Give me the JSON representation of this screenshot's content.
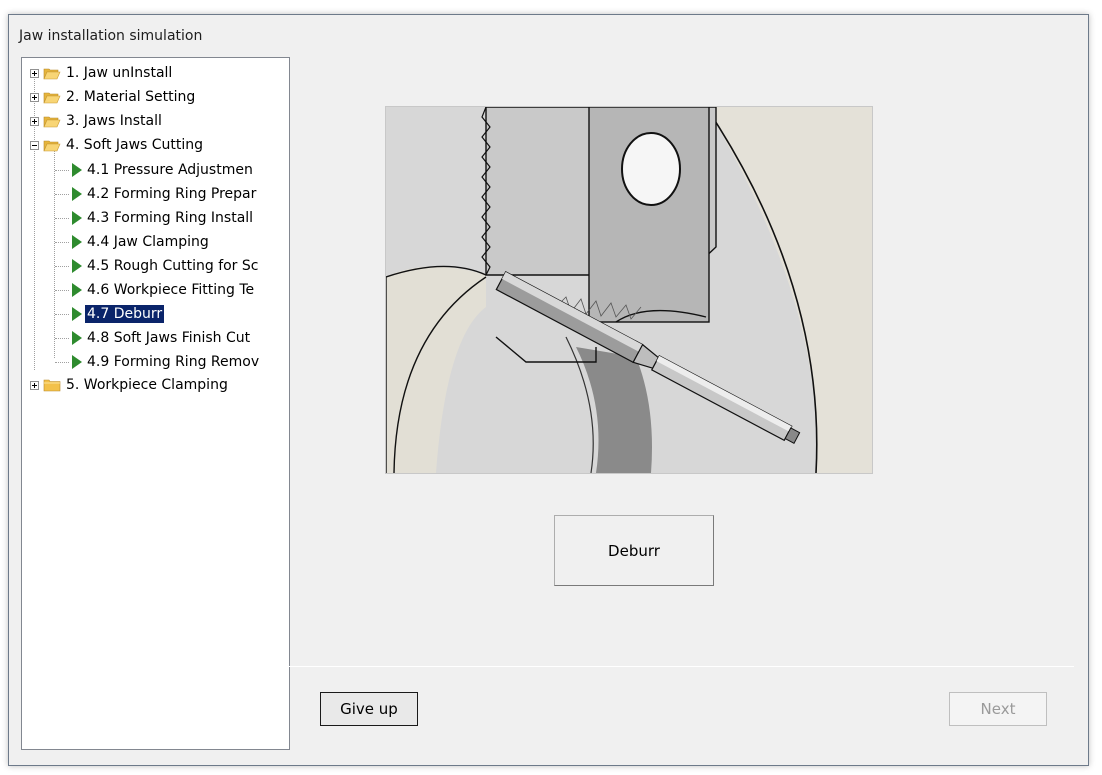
{
  "window": {
    "title": "Jaw installation simulation"
  },
  "tree": {
    "items": [
      {
        "label": "1. Jaw unInstall",
        "kind": "folder-open",
        "expander": "plus"
      },
      {
        "label": "2. Material Setting",
        "kind": "folder-open",
        "expander": "plus"
      },
      {
        "label": "3. Jaws Install",
        "kind": "folder-open",
        "expander": "plus"
      },
      {
        "label": "4. Soft Jaws Cutting",
        "kind": "folder-open",
        "expander": "minus"
      },
      {
        "label": "4.1 Pressure Adjustmen",
        "kind": "step"
      },
      {
        "label": "4.2 Forming Ring Prepar",
        "kind": "step"
      },
      {
        "label": "4.3 Forming Ring Install",
        "kind": "step"
      },
      {
        "label": "4.4 Jaw Clamping",
        "kind": "step"
      },
      {
        "label": "4.5 Rough Cutting for Sc",
        "kind": "step"
      },
      {
        "label": "4.6 Workpiece Fitting Te",
        "kind": "step"
      },
      {
        "label": "4.7 Deburr",
        "kind": "step",
        "selected": true
      },
      {
        "label": "4.8 Soft Jaws Finish Cut",
        "kind": "step"
      },
      {
        "label": "4.9 Forming Ring Remov",
        "kind": "step"
      },
      {
        "label": "5. Workpiece Clamping",
        "kind": "folder-closed",
        "expander": "plus"
      }
    ]
  },
  "main": {
    "action_label": "Deburr"
  },
  "footer": {
    "give_up_label": "Give up",
    "next_label": "Next"
  },
  "colors": {
    "selection": "#0a246a",
    "step_icon": "#2e8b2e",
    "folder": "#f3c14a"
  }
}
